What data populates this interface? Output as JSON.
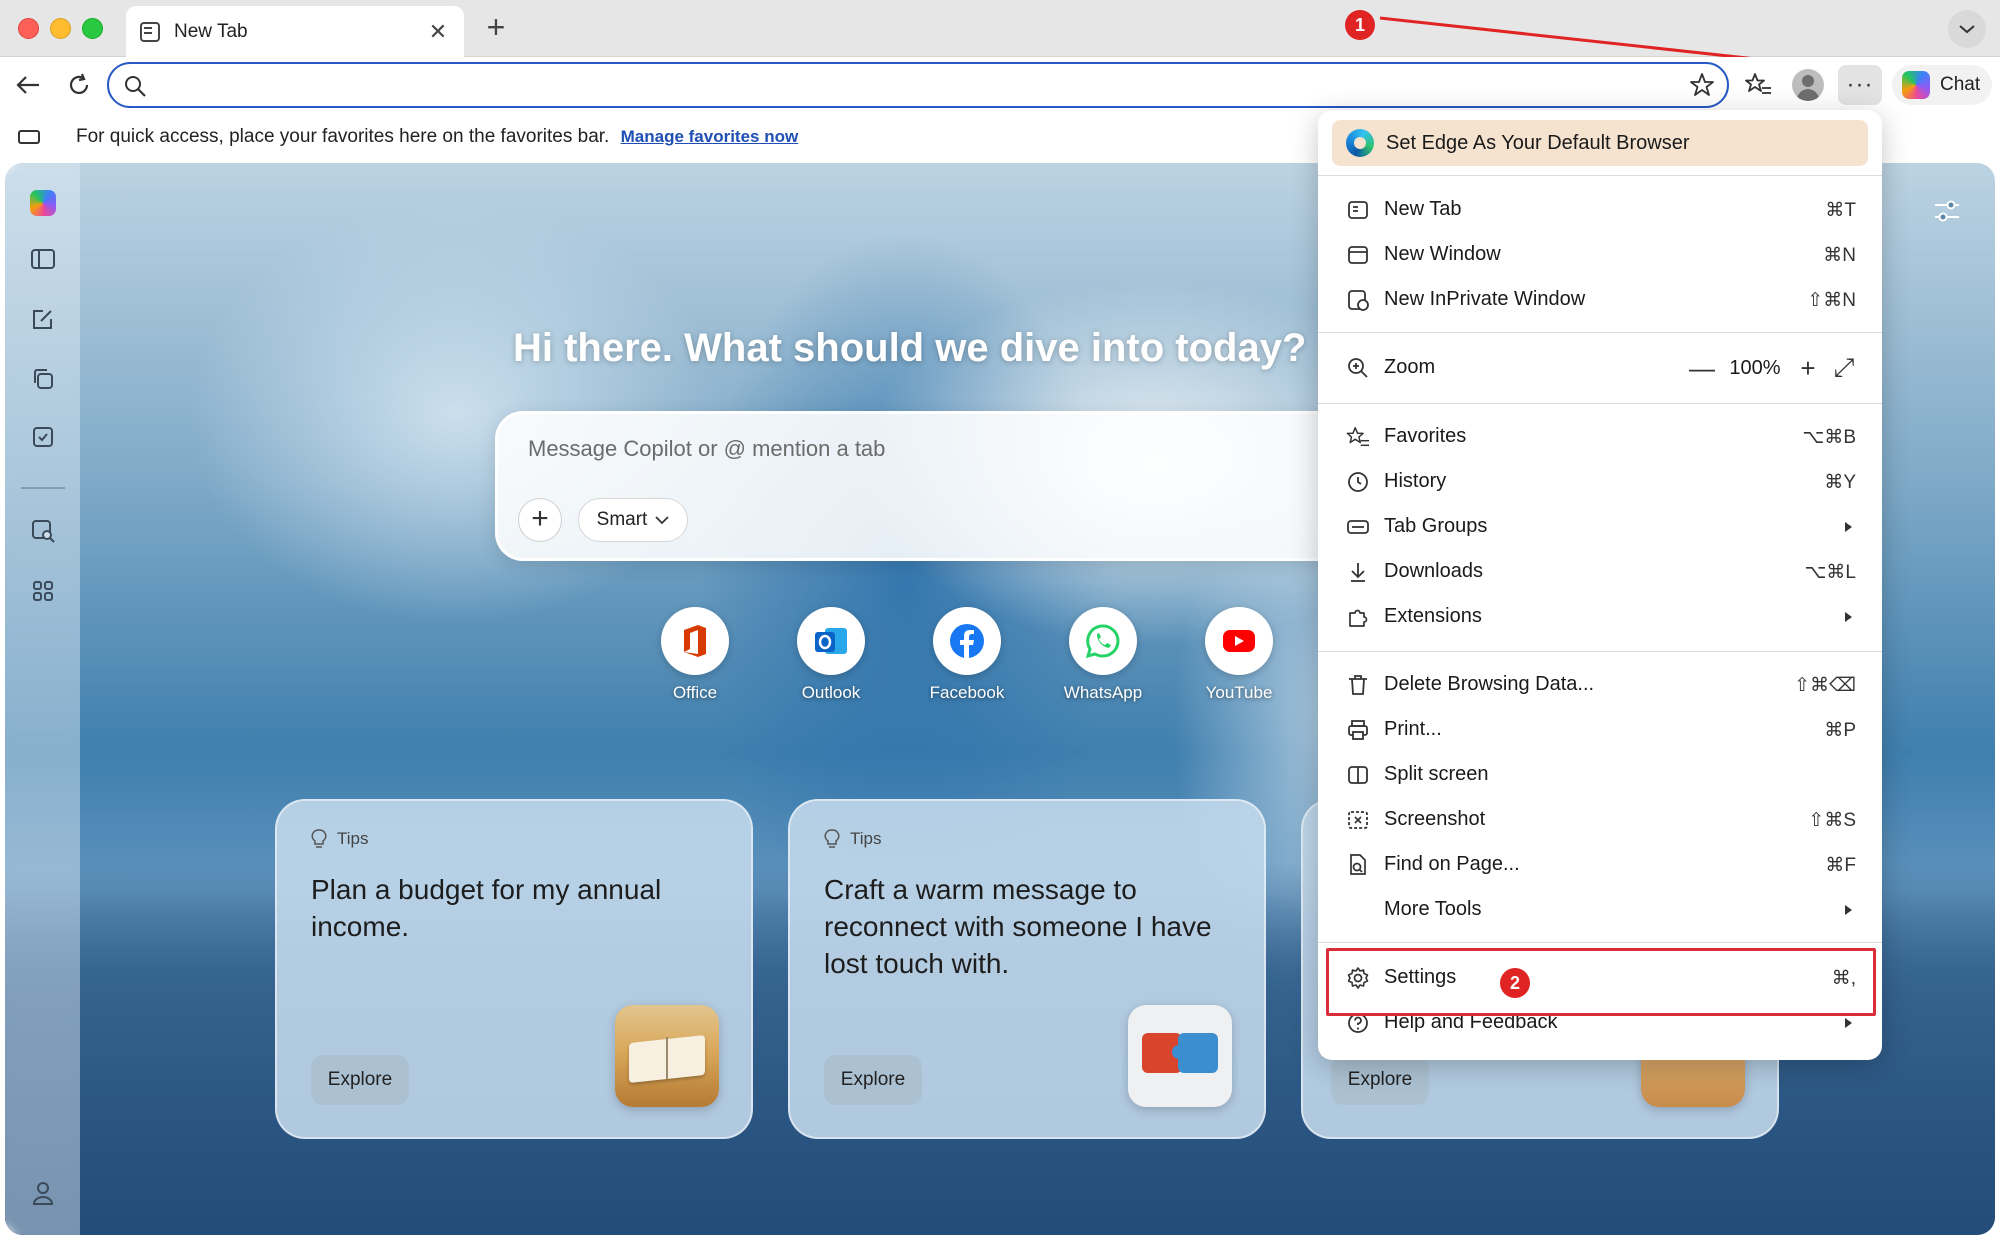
{
  "tab": {
    "title": "New Tab",
    "close_glyph": "✕",
    "new_tab_glyph": "+"
  },
  "toolbar": {
    "address_value": "",
    "address_placeholder": "",
    "more_glyph": "···",
    "chat_label": "Chat"
  },
  "favbar": {
    "text": "For quick access, place your favorites here on the favorites bar.",
    "link": "Manage favorites now"
  },
  "newtab": {
    "headline": "Hi there. What should we dive into today?",
    "composer_placeholder": "Message Copilot or @ mention a tab",
    "smart_label": "Smart",
    "shortcuts": [
      {
        "label": "Office",
        "icon": "office-icon",
        "color": "#d83b01"
      },
      {
        "label": "Outlook",
        "icon": "outlook-icon",
        "color": "#0a64c8"
      },
      {
        "label": "Facebook",
        "icon": "facebook-icon",
        "color": "#1877f2"
      },
      {
        "label": "WhatsApp",
        "icon": "whatsapp-icon",
        "color": "#25d366"
      },
      {
        "label": "YouTube",
        "icon": "youtube-icon",
        "color": "#ff0000"
      }
    ],
    "cards": [
      {
        "kicker": "Tips",
        "title": "Plan a budget for my annual income.",
        "button": "Explore"
      },
      {
        "kicker": "Tips",
        "title": "Craft a warm message to reconnect with someone I have lost touch with.",
        "button": "Explore"
      },
      {
        "kicker": "",
        "title": "",
        "button": "Explore"
      }
    ]
  },
  "menu": {
    "promo": "Set Edge As Your Default Browser",
    "items": [
      {
        "label": "New Tab",
        "shortcut": "⌘T",
        "icon": "new-tab-icon"
      },
      {
        "label": "New Window",
        "shortcut": "⌘N",
        "icon": "new-window-icon"
      },
      {
        "label": "New InPrivate Window",
        "shortcut": "⇧⌘N",
        "icon": "inprivate-icon"
      },
      {
        "label": "Zoom",
        "icon": "zoom-icon",
        "zoom_value": "100%",
        "minus": "—",
        "plus": "+",
        "fullscreen": "⤢"
      },
      {
        "label": "Favorites",
        "shortcut": "⌥⌘B",
        "icon": "favorites-icon"
      },
      {
        "label": "History",
        "shortcut": "⌘Y",
        "icon": "history-icon"
      },
      {
        "label": "Tab Groups",
        "icon": "tab-groups-icon",
        "submenu": true
      },
      {
        "label": "Downloads",
        "shortcut": "⌥⌘L",
        "icon": "downloads-icon"
      },
      {
        "label": "Extensions",
        "icon": "extensions-icon",
        "submenu": true
      },
      {
        "label": "Delete Browsing Data...",
        "shortcut": "⇧⌘⌫",
        "icon": "trash-icon"
      },
      {
        "label": "Print...",
        "shortcut": "⌘P",
        "icon": "print-icon"
      },
      {
        "label": "Split screen",
        "icon": "split-screen-icon"
      },
      {
        "label": "Screenshot",
        "shortcut": "⇧⌘S",
        "icon": "screenshot-icon"
      },
      {
        "label": "Find on Page...",
        "shortcut": "⌘F",
        "icon": "find-icon"
      },
      {
        "label": "More Tools",
        "icon": "",
        "submenu": true
      },
      {
        "label": "Settings",
        "shortcut": "⌘,",
        "icon": "settings-icon"
      },
      {
        "label": "Help and Feedback",
        "icon": "help-icon",
        "submenu": true
      }
    ]
  },
  "annotations": {
    "step1": "1",
    "step2": "2",
    "accent": "#e02424"
  }
}
